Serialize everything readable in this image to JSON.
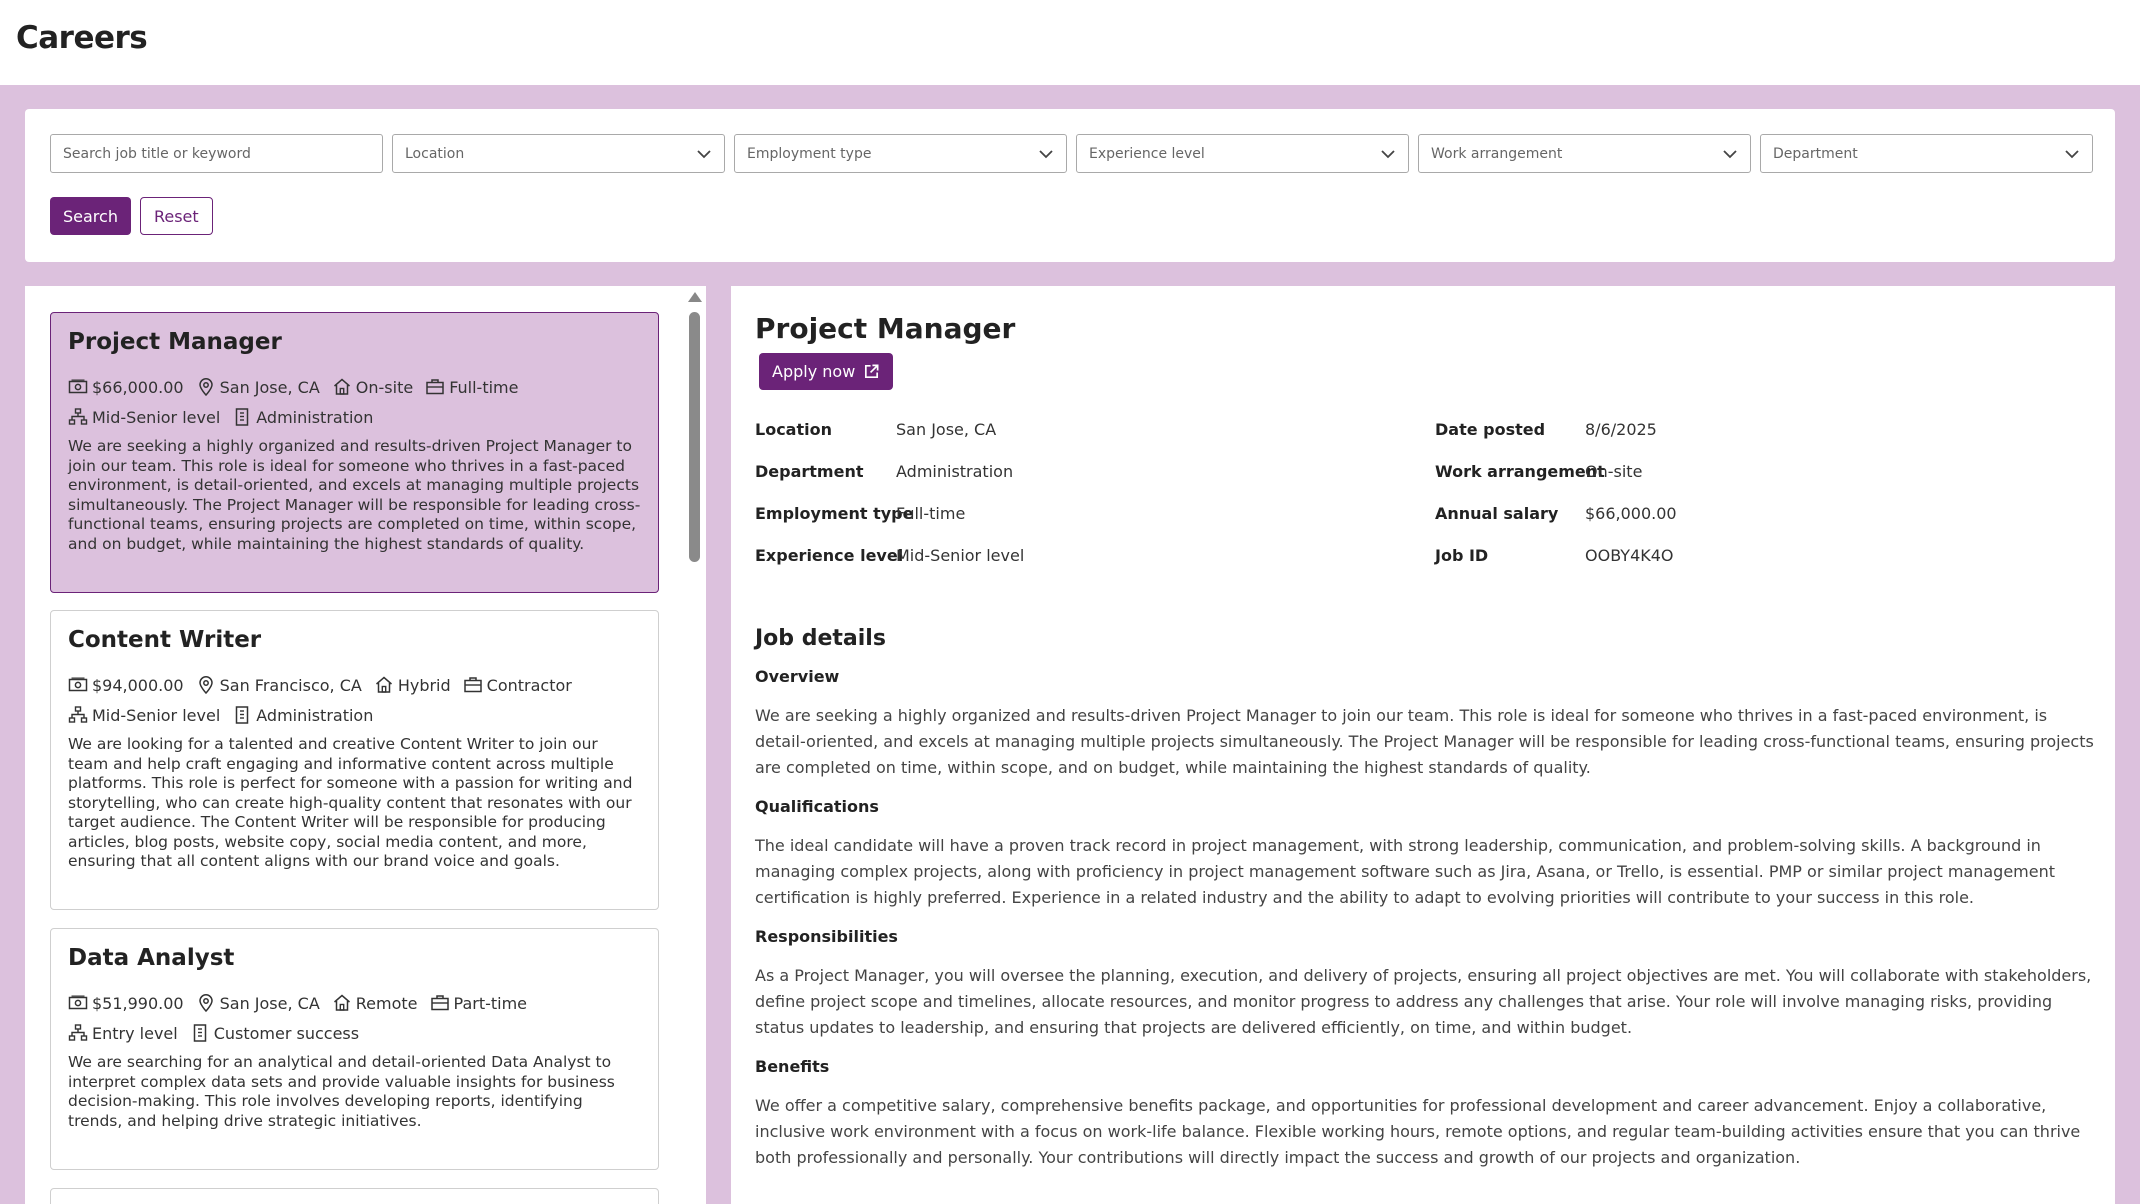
{
  "page": {
    "title": "Careers"
  },
  "filters": {
    "search_placeholder": "Search job title or keyword",
    "location": "Location",
    "employment_type": "Employment type",
    "experience_level": "Experience level",
    "work_arrangement": "Work arrangement",
    "department": "Department",
    "search_label": "Search",
    "reset_label": "Reset"
  },
  "jobs": [
    {
      "title": "Project Manager",
      "salary": "$66,000.00",
      "location": "San Jose, CA",
      "arrangement": "On-site",
      "type": "Full-time",
      "level": "Mid-Senior level",
      "department": "Administration",
      "description": "We are seeking a highly organized and results-driven Project Manager to join our team. This role is ideal for someone who thrives in a fast-paced environment, is detail-oriented, and excels at managing multiple projects simultaneously. The Project Manager will be responsible for leading cross-functional teams, ensuring projects are completed on time, within scope, and on budget, while maintaining the highest standards of quality."
    },
    {
      "title": "Content Writer",
      "salary": "$94,000.00",
      "location": "San Francisco, CA",
      "arrangement": "Hybrid",
      "type": "Contractor",
      "level": "Mid-Senior level",
      "department": "Administration",
      "description": "We are looking for a talented and creative Content Writer to join our team and help craft engaging and informative content across multiple platforms. This role is perfect for someone with a passion for writing and storytelling, who can create high-quality content that resonates with our target audience. The Content Writer will be responsible for producing articles, blog posts, website copy, social media content, and more, ensuring that all content aligns with our brand voice and goals."
    },
    {
      "title": "Data Analyst",
      "salary": "$51,990.00",
      "location": "San Jose, CA",
      "arrangement": "Remote",
      "type": "Part-time",
      "level": "Entry level",
      "department": "Customer success",
      "description": "We are searching for an analytical and detail-oriented Data Analyst to interpret complex data sets and provide valuable insights for business decision-making. This role involves developing reports, identifying trends, and helping drive strategic initiatives."
    }
  ],
  "detail": {
    "title": "Project Manager",
    "apply_label": "Apply now",
    "labels": {
      "location": "Location",
      "department": "Department",
      "employment_type": "Employment type",
      "experience_level": "Experience level",
      "date_posted": "Date posted",
      "work_arrangement": "Work arrangement",
      "annual_salary": "Annual salary",
      "job_id": "Job ID"
    },
    "values": {
      "location": "San Jose, CA",
      "department": "Administration",
      "employment_type": "Full-time",
      "experience_level": "Mid-Senior level",
      "date_posted": "8/6/2025",
      "work_arrangement": "On-site",
      "annual_salary": "$66,000.00",
      "job_id": "OOBY4K4O"
    },
    "job_details_heading": "Job details",
    "sections": [
      {
        "heading": "Overview",
        "body": "We are seeking a highly organized and results-driven Project Manager to join our team. This role is ideal for someone who thrives in a fast-paced environment, is detail-oriented, and excels at managing multiple projects simultaneously. The Project Manager will be responsible for leading cross-functional teams, ensuring projects are completed on time, within scope, and on budget, while maintaining the highest standards of quality."
      },
      {
        "heading": "Qualifications",
        "body": "The ideal candidate will have a proven track record in project management, with strong leadership, communication, and problem-solving skills. A background in managing complex projects, along with proficiency in project management software such as Jira, Asana, or Trello, is essential. PMP or similar project management certification is highly preferred. Experience in a related industry and the ability to adapt to evolving priorities will contribute to your success in this role."
      },
      {
        "heading": "Responsibilities",
        "body": "As a Project Manager, you will oversee the planning, execution, and delivery of projects, ensuring all project objectives are met. You will collaborate with stakeholders, define project scope and timelines, allocate resources, and monitor progress to address any challenges that arise. Your role will involve managing risks, providing status updates to leadership, and ensuring that projects are delivered efficiently, on time, and within budget."
      },
      {
        "heading": "Benefits",
        "body": "We offer a competitive salary, comprehensive benefits package, and opportunities for professional development and career advancement. Enjoy a collaborative, inclusive work environment with a focus on work-life balance. Flexible working hours, remote options, and regular team-building activities ensure that you can thrive both professionally and personally. Your contributions will directly impact the success and growth of our projects and organization."
      }
    ]
  },
  "colors": {
    "brand": "#6b2378",
    "band": "#dcc1dd"
  }
}
